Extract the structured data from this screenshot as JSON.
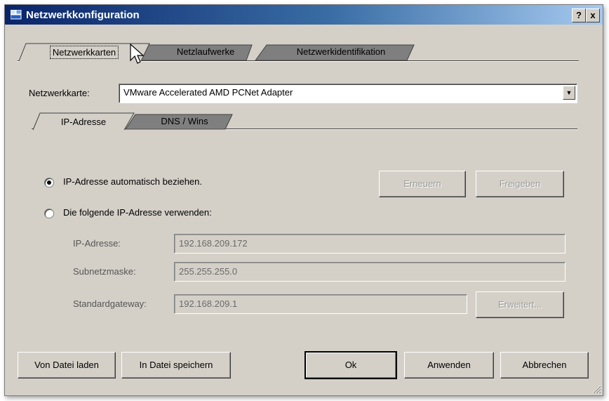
{
  "window": {
    "title": "Netzwerkkonfiguration",
    "help_label": "?",
    "close_label": "x"
  },
  "main_tabs": [
    {
      "label": "Netzwerkkarten",
      "active": true
    },
    {
      "label": "Netzlaufwerke",
      "active": false
    },
    {
      "label": "Netzwerkidentifikation",
      "active": false
    }
  ],
  "adapter": {
    "label": "Netzwerkkarte:",
    "value": "VMware Accelerated AMD PCNet Adapter"
  },
  "sub_tabs": [
    {
      "label": "IP-Adresse",
      "active": true
    },
    {
      "label": "DNS / Wins",
      "active": false
    }
  ],
  "ip": {
    "auto_label": "IP-Adresse automatisch beziehen.",
    "manual_label": "Die folgende IP-Adresse verwenden:",
    "auto_selected": true,
    "renew_button": "Erneuern",
    "release_button": "Freigeben",
    "address_label": "IP-Adresse:",
    "address_value": "192.168.209.172",
    "subnet_label": "Subnetzmaske:",
    "subnet_value": "255.255.255.0",
    "gateway_label": "Standardgateway:",
    "gateway_value": "192.168.209.1",
    "advanced_button": "Erweitert..."
  },
  "footer": {
    "load_button": "Von Datei laden",
    "save_button": "In Datei speichern",
    "ok_button": "Ok",
    "apply_button": "Anwenden",
    "cancel_button": "Abbrechen"
  },
  "colors": {
    "titlebar_start": "#0a246a",
    "titlebar_end": "#a6caf0",
    "face": "#d4d0c8",
    "inactive_tab": "#7f7f7f"
  }
}
